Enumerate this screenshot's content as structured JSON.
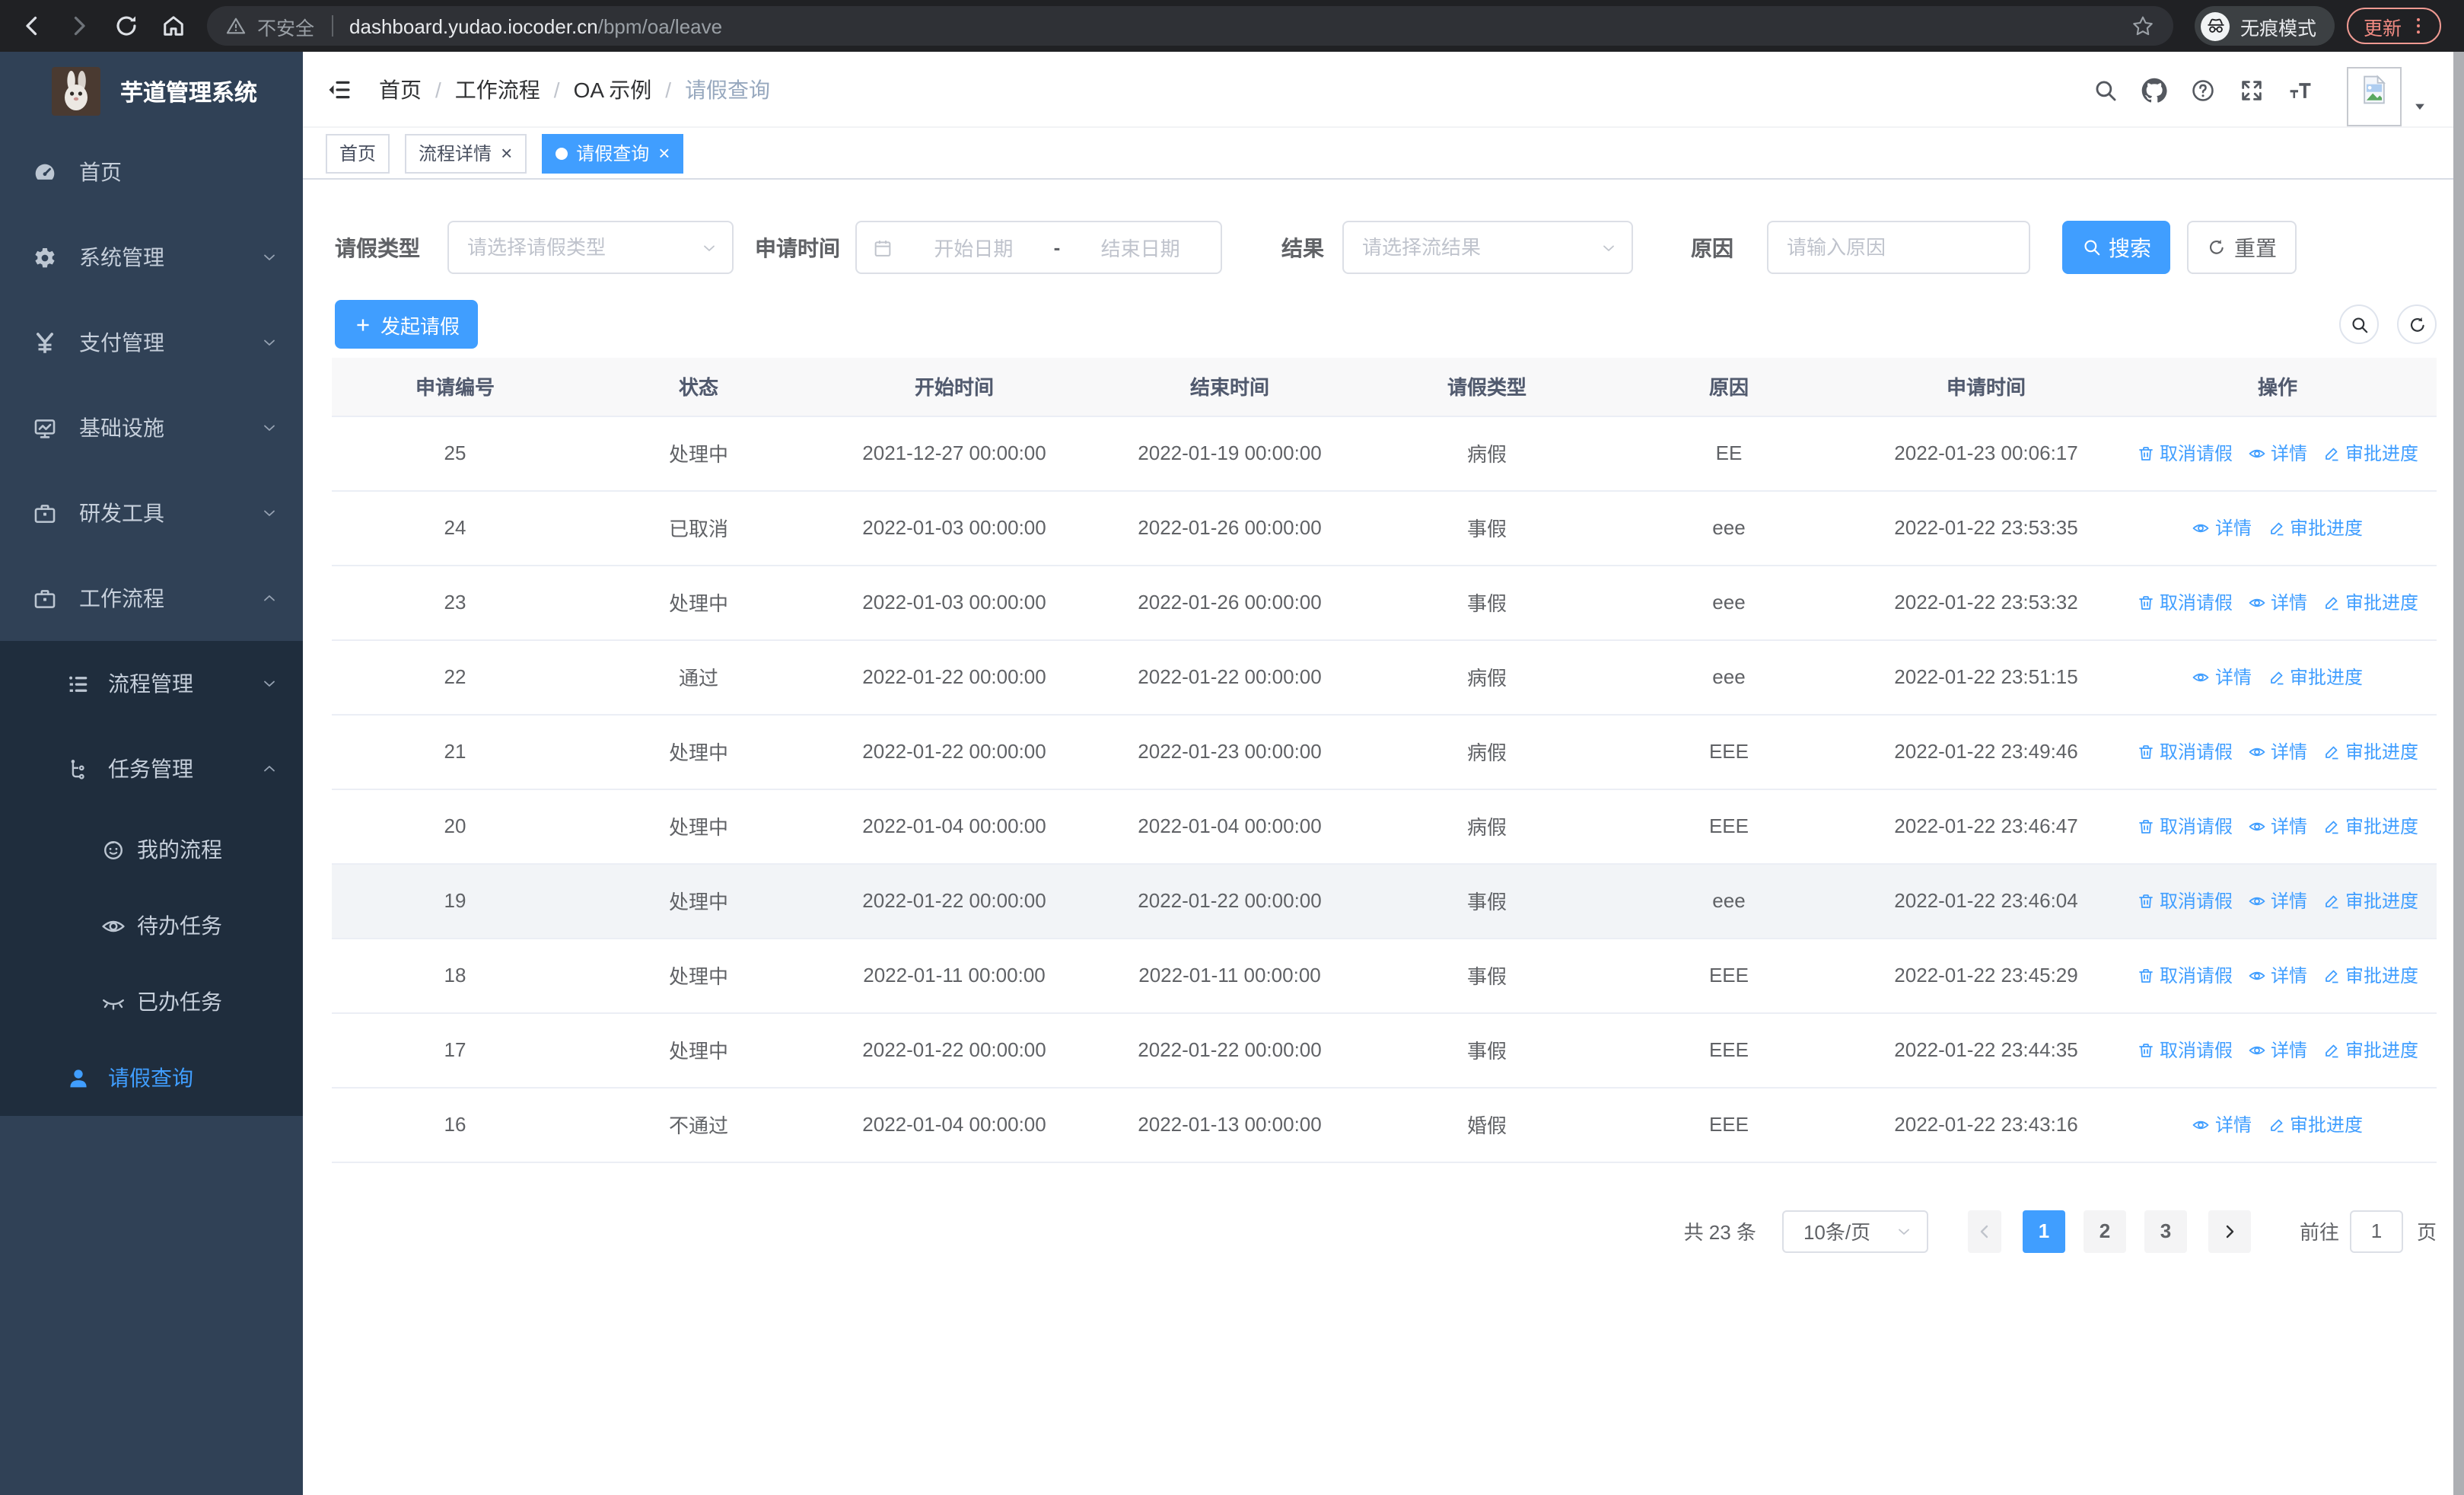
{
  "browser": {
    "security_label": "不安全",
    "url_host": "dashboard.yudao.iocoder.cn",
    "url_path": "/bpm/oa/leave",
    "incognito_label": "无痕模式",
    "update_label": "更新"
  },
  "sidebar": {
    "title": "芋道管理系统",
    "items": [
      {
        "icon": "dashboard-icon",
        "label": "首页",
        "level": 1
      },
      {
        "icon": "gear-icon",
        "label": "系统管理",
        "level": 1,
        "chevron": "down"
      },
      {
        "icon": "payment-icon",
        "label": "支付管理",
        "level": 1,
        "chevron": "down"
      },
      {
        "icon": "infrastructure-icon",
        "label": "基础设施",
        "level": 1,
        "chevron": "down"
      },
      {
        "icon": "devtools-icon",
        "label": "研发工具",
        "level": 1,
        "chevron": "down"
      },
      {
        "icon": "workflow-icon",
        "label": "工作流程",
        "level": 1,
        "chevron": "up"
      },
      {
        "icon": "process-icon",
        "label": "流程管理",
        "level": 2,
        "chevron": "down",
        "submenu": true
      },
      {
        "icon": "task-icon",
        "label": "任务管理",
        "level": 2,
        "chevron": "up",
        "submenu": true
      },
      {
        "icon": "my-process-icon",
        "label": "我的流程",
        "level": 3,
        "submenu": true
      },
      {
        "icon": "todo-icon",
        "label": "待办任务",
        "level": 3,
        "submenu": true
      },
      {
        "icon": "done-icon",
        "label": "已办任务",
        "level": 3,
        "submenu": true
      },
      {
        "icon": "user-icon",
        "label": "请假查询",
        "level": 2,
        "submenu": true,
        "active": true
      }
    ]
  },
  "header": {
    "breadcrumb": [
      "首页",
      "工作流程",
      "OA 示例",
      "请假查询"
    ]
  },
  "tabs": [
    {
      "label": "首页",
      "closable": false,
      "active": false
    },
    {
      "label": "流程详情",
      "closable": true,
      "active": false
    },
    {
      "label": "请假查询",
      "closable": true,
      "active": true
    }
  ],
  "filters": {
    "leave_type": {
      "label": "请假类型",
      "placeholder": "请选择请假类型"
    },
    "apply_time": {
      "label": "申请时间",
      "start_placeholder": "开始日期",
      "separator": "-",
      "end_placeholder": "结束日期"
    },
    "result": {
      "label": "结果",
      "placeholder": "请选择流结果"
    },
    "reason": {
      "label": "原因",
      "placeholder": "请输入原因"
    },
    "search_label": "搜索",
    "reset_label": "重置"
  },
  "toolbar": {
    "create_label": "发起请假"
  },
  "table": {
    "columns": [
      "申请编号",
      "状态",
      "开始时间",
      "结束时间",
      "请假类型",
      "原因",
      "申请时间",
      "操作"
    ],
    "action_labels": {
      "cancel": "取消请假",
      "detail": "详情",
      "progress": "审批进度"
    },
    "rows": [
      {
        "id": "25",
        "status": "处理中",
        "start": "2021-12-27 00:00:00",
        "end": "2022-01-19 00:00:00",
        "type": "病假",
        "reason": "EE",
        "applied": "2022-01-23 00:06:17",
        "actions": [
          "cancel",
          "detail",
          "progress"
        ],
        "highlight": false
      },
      {
        "id": "24",
        "status": "已取消",
        "start": "2022-01-03 00:00:00",
        "end": "2022-01-26 00:00:00",
        "type": "事假",
        "reason": "eee",
        "applied": "2022-01-22 23:53:35",
        "actions": [
          "detail",
          "progress"
        ],
        "highlight": false
      },
      {
        "id": "23",
        "status": "处理中",
        "start": "2022-01-03 00:00:00",
        "end": "2022-01-26 00:00:00",
        "type": "事假",
        "reason": "eee",
        "applied": "2022-01-22 23:53:32",
        "actions": [
          "cancel",
          "detail",
          "progress"
        ],
        "highlight": false
      },
      {
        "id": "22",
        "status": "通过",
        "start": "2022-01-22 00:00:00",
        "end": "2022-01-22 00:00:00",
        "type": "病假",
        "reason": "eee",
        "applied": "2022-01-22 23:51:15",
        "actions": [
          "detail",
          "progress"
        ],
        "highlight": false
      },
      {
        "id": "21",
        "status": "处理中",
        "start": "2022-01-22 00:00:00",
        "end": "2022-01-23 00:00:00",
        "type": "病假",
        "reason": "EEE",
        "applied": "2022-01-22 23:49:46",
        "actions": [
          "cancel",
          "detail",
          "progress"
        ],
        "highlight": false
      },
      {
        "id": "20",
        "status": "处理中",
        "start": "2022-01-04 00:00:00",
        "end": "2022-01-04 00:00:00",
        "type": "病假",
        "reason": "EEE",
        "applied": "2022-01-22 23:46:47",
        "actions": [
          "cancel",
          "detail",
          "progress"
        ],
        "highlight": false
      },
      {
        "id": "19",
        "status": "处理中",
        "start": "2022-01-22 00:00:00",
        "end": "2022-01-22 00:00:00",
        "type": "事假",
        "reason": "eee",
        "applied": "2022-01-22 23:46:04",
        "actions": [
          "cancel",
          "detail",
          "progress"
        ],
        "highlight": true
      },
      {
        "id": "18",
        "status": "处理中",
        "start": "2022-01-11 00:00:00",
        "end": "2022-01-11 00:00:00",
        "type": "事假",
        "reason": "EEE",
        "applied": "2022-01-22 23:45:29",
        "actions": [
          "cancel",
          "detail",
          "progress"
        ],
        "highlight": false
      },
      {
        "id": "17",
        "status": "处理中",
        "start": "2022-01-22 00:00:00",
        "end": "2022-01-22 00:00:00",
        "type": "事假",
        "reason": "EEE",
        "applied": "2022-01-22 23:44:35",
        "actions": [
          "cancel",
          "detail",
          "progress"
        ],
        "highlight": false
      },
      {
        "id": "16",
        "status": "不通过",
        "start": "2022-01-04 00:00:00",
        "end": "2022-01-13 00:00:00",
        "type": "婚假",
        "reason": "EEE",
        "applied": "2022-01-22 23:43:16",
        "actions": [
          "detail",
          "progress"
        ],
        "highlight": false
      }
    ]
  },
  "pagination": {
    "total_label": "共 23 条",
    "page_size_label": "10条/页",
    "pages": [
      "1",
      "2",
      "3"
    ],
    "active_page": "1",
    "goto_label": "前往",
    "goto_value": "1",
    "unit_label": "页"
  },
  "colors": {
    "accent": "#409eff",
    "sidebar_bg": "#304156",
    "submenu_bg": "#1f2d3d",
    "incognito_update": "#f28b82"
  }
}
